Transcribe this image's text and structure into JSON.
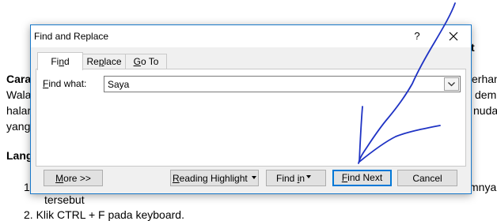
{
  "document": {
    "lines": [
      {
        "id": "heading_tail",
        "text": "t",
        "bold": true
      },
      {
        "id": "cara",
        "text": "Cara",
        "bold": true
      },
      {
        "id": "sederhana",
        "text": "erhana",
        "bold": false
      },
      {
        "id": "wala",
        "text": "Wala",
        "bold": false
      },
      {
        "id": "dem",
        "text": "dem",
        "bold": false
      },
      {
        "id": "halar",
        "text": "halar",
        "bold": false
      },
      {
        "id": "mudah",
        "text": "nudah",
        "bold": false
      },
      {
        "id": "yang",
        "text": "yang",
        "bold": false
      },
      {
        "id": "lang",
        "text": "Lang",
        "bold": true
      },
      {
        "id": "num1",
        "text": "1",
        "bold": false
      },
      {
        "id": "mnya",
        "text": "mnya",
        "bold": false
      },
      {
        "id": "tersebut",
        "text": "tersebut",
        "bold": false
      },
      {
        "id": "step2",
        "text": "2.  Klik CTRL + F pada keyboard.",
        "bold": false
      }
    ]
  },
  "dialog": {
    "title": "Find and Replace",
    "help_glyph": "?",
    "tabs": [
      {
        "pre": "Fi",
        "accel": "n",
        "post": "d",
        "active": true
      },
      {
        "pre": "Re",
        "accel": "p",
        "post": "lace",
        "active": false
      },
      {
        "pre": "",
        "accel": "G",
        "post": "o To",
        "active": false
      }
    ],
    "find_what": {
      "pre": "",
      "accel": "F",
      "post": "ind what:"
    },
    "find_value": "Saya",
    "buttons": {
      "more": {
        "pre": "",
        "accel": "M",
        "post": "ore >>"
      },
      "reading_highlight": {
        "pre": "",
        "accel": "R",
        "post": "eading Highlight"
      },
      "find_in": {
        "pre": "Find ",
        "accel": "i",
        "post": "n"
      },
      "find_next": {
        "pre": "",
        "accel": "F",
        "post": "ind Next"
      },
      "cancel": {
        "label": "Cancel"
      }
    }
  },
  "colors": {
    "accent": "#0078d7",
    "window_border": "#1979ca",
    "dialog_bg": "#f0f0f0",
    "pen_ink": "#1f33c4"
  },
  "icons": [
    "close-icon",
    "chevron-down-icon",
    "dropdown-arrow-icon",
    "pen-arrow-annotation"
  ]
}
